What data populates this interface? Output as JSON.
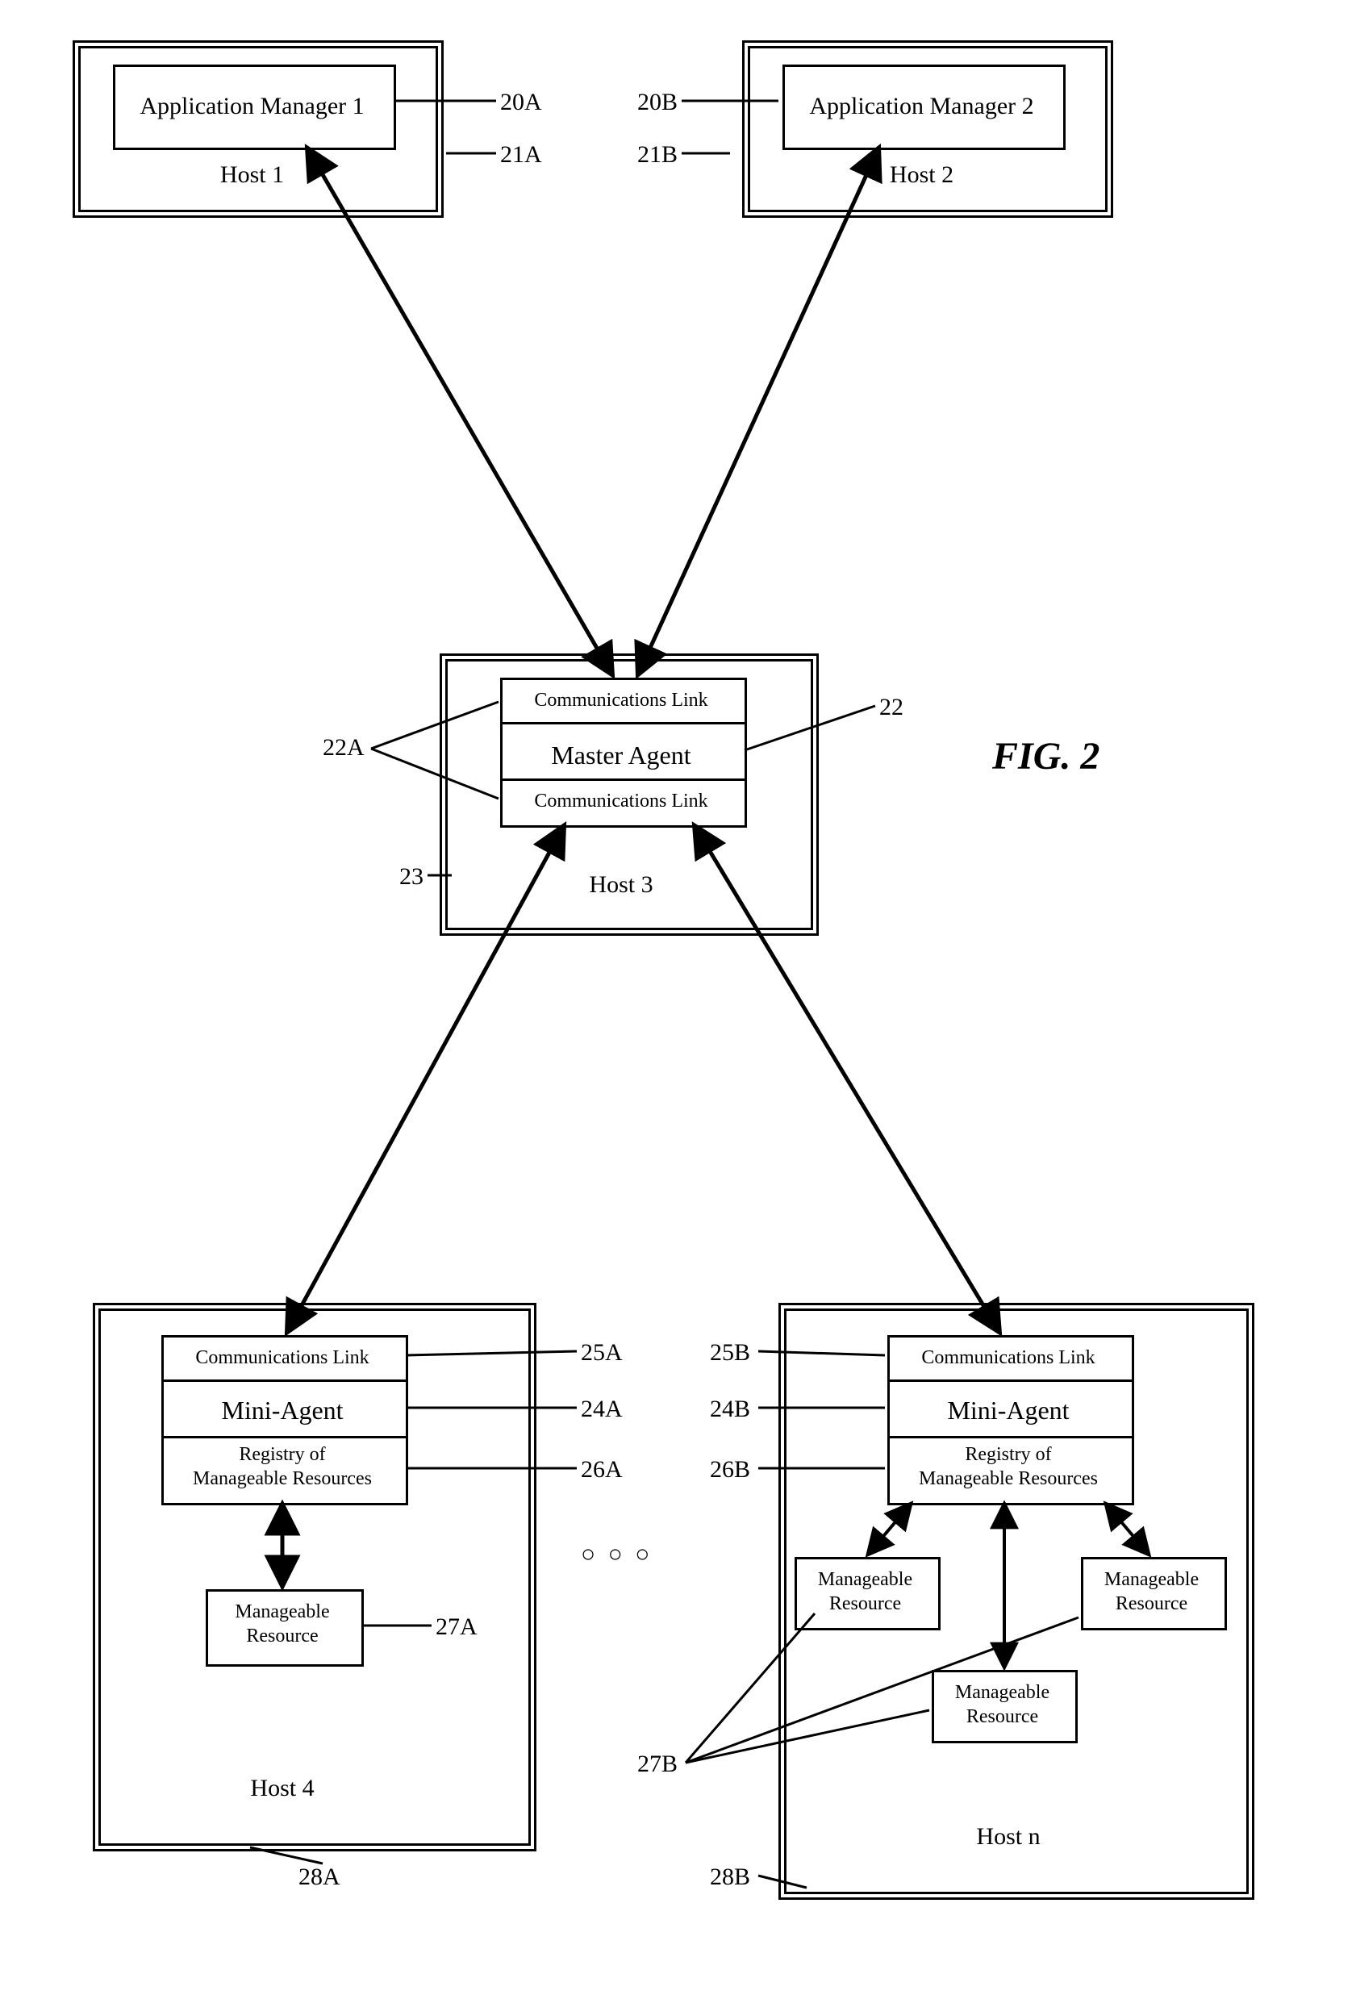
{
  "figure_label": "FIG. 2",
  "hosts": {
    "h1": {
      "label": "Host 1",
      "app": "Application Manager 1",
      "ref_app": "20A",
      "ref_host": "21A"
    },
    "h2": {
      "label": "Host 2",
      "app": "Application Manager 2",
      "ref_app": "20B",
      "ref_host": "21B"
    },
    "h3": {
      "label": "Host 3",
      "comm_top": "Communications Link",
      "master": "Master Agent",
      "comm_bot": "Communications Link",
      "ref_comm": "22A",
      "ref_master": "22",
      "ref_host": "23"
    },
    "h4": {
      "label": "Host 4",
      "comm": "Communications Link",
      "agent": "Mini-Agent",
      "registry_l1": "Registry of",
      "registry_l2": "Manageable Resources",
      "resource_l1": "Manageable",
      "resource_l2": "Resource",
      "ref_comm": "25A",
      "ref_agent": "24A",
      "ref_registry": "26A",
      "ref_resource": "27A",
      "ref_host": "28A"
    },
    "hn": {
      "label": "Host n",
      "comm": "Communications Link",
      "agent": "Mini-Agent",
      "registry_l1": "Registry of",
      "registry_l2": "Manageable Resources",
      "res_l1": "Manageable",
      "res_l2": "Resource",
      "ref_comm": "25B",
      "ref_agent": "24B",
      "ref_registry": "26B",
      "ref_resources": "27B",
      "ref_host": "28B"
    }
  },
  "ellipsis": "○  ○  ○"
}
